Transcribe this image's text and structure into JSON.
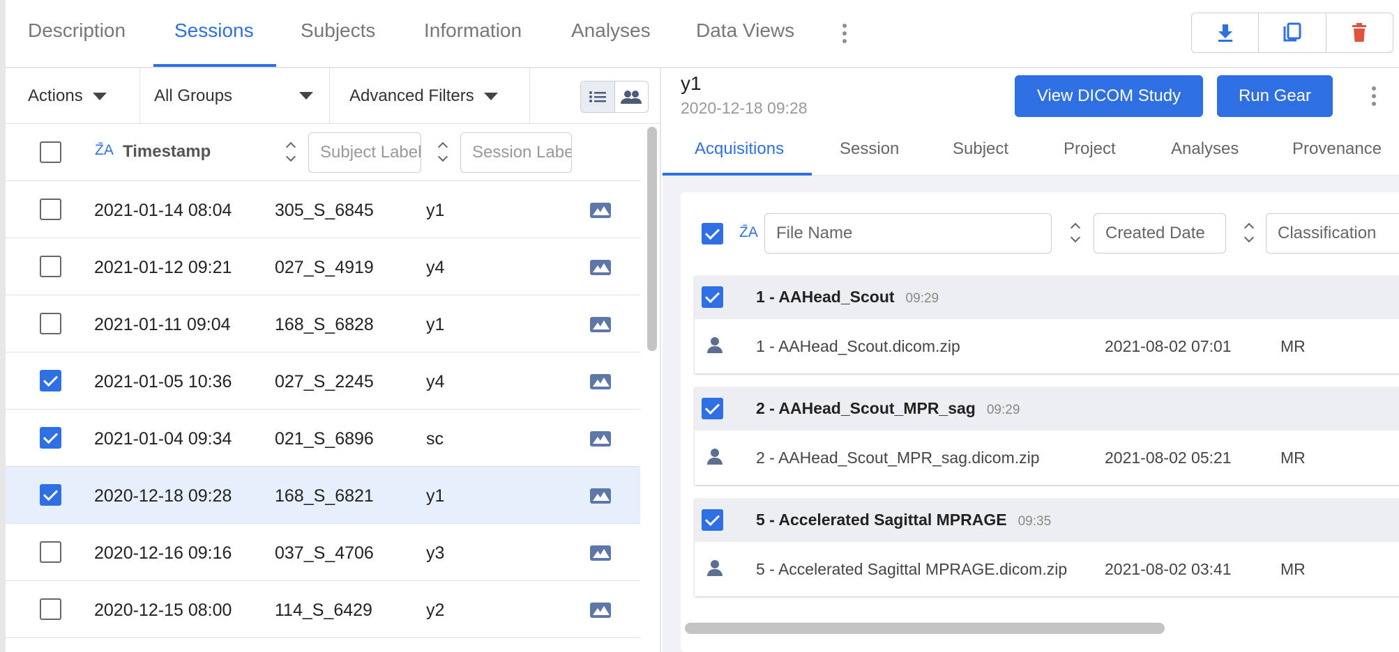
{
  "top_tabs": {
    "description": "Description",
    "sessions": "Sessions",
    "subjects": "Subjects",
    "information": "Information",
    "analyses": "Analyses",
    "data_views": "Data Views"
  },
  "top_actions": {
    "download_icon": "download-icon",
    "copy_icon": "copy-icon",
    "delete_icon": "trash-icon",
    "accent": "#2f6fe4",
    "danger": "#e0533d"
  },
  "toolbar": {
    "actions_label": "Actions",
    "groups_label": "All Groups",
    "advanced_filters_label": "Advanced Filters"
  },
  "sessions_table": {
    "timestamp_header": "Timestamp",
    "subject_filter_placeholder": "Subject Label",
    "session_filter_placeholder": "Session Label",
    "rows": [
      {
        "timestamp": "2021-01-14 08:04",
        "subject": "305_S_6845",
        "session": "y1",
        "checked": false,
        "selected": false
      },
      {
        "timestamp": "2021-01-12 09:21",
        "subject": "027_S_4919",
        "session": "y4",
        "checked": false,
        "selected": false
      },
      {
        "timestamp": "2021-01-11 09:04",
        "subject": "168_S_6828",
        "session": "y1",
        "checked": false,
        "selected": false
      },
      {
        "timestamp": "2021-01-05 10:36",
        "subject": "027_S_2245",
        "session": "y4",
        "checked": true,
        "selected": false
      },
      {
        "timestamp": "2021-01-04 09:34",
        "subject": "021_S_6896",
        "session": "sc",
        "checked": true,
        "selected": false
      },
      {
        "timestamp": "2020-12-18 09:28",
        "subject": "168_S_6821",
        "session": "y1",
        "checked": true,
        "selected": true
      },
      {
        "timestamp": "2020-12-16 09:16",
        "subject": "037_S_4706",
        "session": "y3",
        "checked": false,
        "selected": false
      },
      {
        "timestamp": "2020-12-15 08:00",
        "subject": "114_S_6429",
        "session": "y2",
        "checked": false,
        "selected": false
      }
    ]
  },
  "session_detail": {
    "title": "y1",
    "date": "2020-12-18 09:28",
    "view_dicom_label": "View DICOM Study",
    "run_gear_label": "Run Gear",
    "tabs": {
      "acquisitions": "Acquisitions",
      "session": "Session",
      "subject": "Subject",
      "project": "Project",
      "analyses": "Analyses",
      "provenance": "Provenance"
    },
    "file_table": {
      "file_name_placeholder": "File Name",
      "created_date_placeholder": "Created Date",
      "classification_placeholder": "Classification"
    },
    "acquisitions": [
      {
        "title": "1 - AAHead_Scout",
        "time": "09:29",
        "file": "1 - AAHead_Scout.dicom.zip",
        "created": "2021-08-02 07:01",
        "classification": "MR"
      },
      {
        "title": "2 - AAHead_Scout_MPR_sag",
        "time": "09:29",
        "file": "2 - AAHead_Scout_MPR_sag.dicom.zip",
        "created": "2021-08-02 05:21",
        "classification": "MR"
      },
      {
        "title": "5 - Accelerated Sagittal MPRAGE",
        "time": "09:35",
        "file": "5 - Accelerated Sagittal MPRAGE.dicom.zip",
        "created": "2021-08-02 03:41",
        "classification": "MR"
      }
    ]
  }
}
